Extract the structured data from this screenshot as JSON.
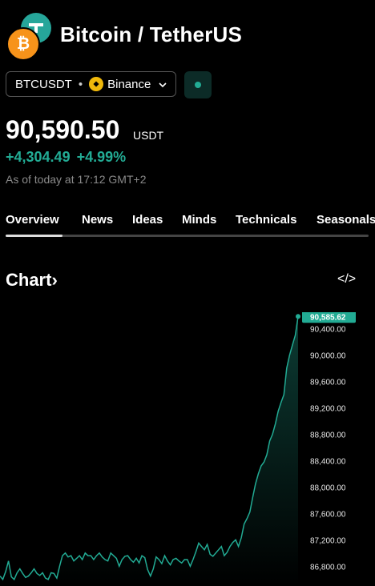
{
  "header": {
    "title": "Bitcoin / TetherUS"
  },
  "logos": {
    "base_icon": "bitcoin-icon",
    "quote_icon": "tether-icon",
    "btc_glyph": "₿"
  },
  "symbol": {
    "ticker": "BTCUSDT",
    "separator": "•",
    "exchange": "Binance",
    "exchange_icon": "binance-icon"
  },
  "quote": {
    "price": "90,590.50",
    "currency": "USDT",
    "change": "+4,304.49",
    "change_pct": "+4.99%",
    "as_of": "As of today at 17:12 GMT+2"
  },
  "tabs": [
    {
      "label": "Overview",
      "active": true
    },
    {
      "label": "News"
    },
    {
      "label": "Ideas"
    },
    {
      "label": "Minds"
    },
    {
      "label": "Technicals"
    },
    {
      "label": "Seasonals"
    }
  ],
  "chart_section": {
    "heading": "Chart",
    "arrow": "›",
    "embed_label": "</>"
  },
  "colors": {
    "accent": "#22ab94",
    "background": "#000000"
  },
  "chart_data": {
    "type": "area",
    "last_value_label": "90,585.62",
    "y_ticks": [
      "90,400.00",
      "90,000.00",
      "89,600.00",
      "89,200.00",
      "88,800.00",
      "88,400.00",
      "88,000.00",
      "87,600.00",
      "87,200.00",
      "86,800.00"
    ],
    "ylim": [
      86500,
      90650
    ],
    "values": [
      86650,
      86600,
      86720,
      86880,
      86640,
      86600,
      86700,
      86760,
      86690,
      86630,
      86650,
      86700,
      86760,
      86690,
      86660,
      86700,
      86620,
      86600,
      86700,
      86690,
      86620,
      86800,
      86960,
      87000,
      86940,
      86960,
      86880,
      86920,
      86960,
      86900,
      87000,
      86960,
      86960,
      86900,
      86960,
      87000,
      86940,
      86900,
      86880,
      87000,
      86960,
      86920,
      86800,
      86900,
      86950,
      86960,
      86900,
      86860,
      86920,
      86850,
      86960,
      86930,
      86750,
      86650,
      86760,
      86940,
      86900,
      86840,
      86960,
      86880,
      86820,
      86900,
      86920,
      86880,
      86850,
      86900,
      86900,
      86800,
      86900,
      87020,
      87150,
      87100,
      87050,
      87130,
      86980,
      86950,
      87000,
      87050,
      87100,
      86960,
      87010,
      87100,
      87160,
      87200,
      87100,
      87230,
      87440,
      87520,
      87620,
      87840,
      88050,
      88200,
      88320,
      88380,
      88490,
      88700,
      88800,
      88960,
      89150,
      89280,
      89400,
      89800,
      90000,
      90150,
      90300,
      90585.62
    ]
  }
}
